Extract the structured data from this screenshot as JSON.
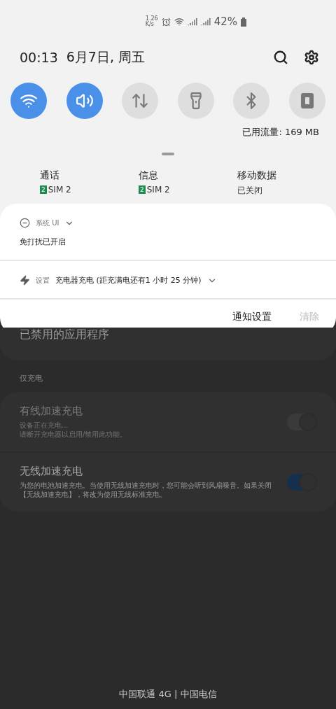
{
  "status_bar": {
    "speed_value": "1.26",
    "speed_unit": "K/s",
    "battery": "42%"
  },
  "header": {
    "time": "00:13",
    "date": "6月7日, 周五"
  },
  "quick_toggles": [
    {
      "kind": "wifi",
      "on": true
    },
    {
      "kind": "sound",
      "on": true
    },
    {
      "kind": "data",
      "on": false
    },
    {
      "kind": "flashlight",
      "on": false
    },
    {
      "kind": "bluetooth",
      "on": false
    },
    {
      "kind": "power",
      "on": false
    }
  ],
  "data_usage": "已用流量: 169 MB",
  "sim_settings": [
    {
      "label": "通话",
      "sim_badge": "2",
      "value": "SIM 2"
    },
    {
      "label": "信息",
      "sim_badge": "2",
      "value": "SIM 2"
    },
    {
      "label": "移动数据",
      "value": "已关闭"
    }
  ],
  "notifications": [
    {
      "kind": "dnd",
      "app": "系统 UI",
      "text": "免打扰已开启"
    },
    {
      "kind": "charging",
      "app": "设置",
      "text": "充电器充电 (距充满电还有1 小时 25 分钟)"
    }
  ],
  "notification_actions": [
    {
      "label": "通知设置",
      "disabled": false
    },
    {
      "label": "清除",
      "disabled": true
    }
  ],
  "background_page": {
    "top_item": "已禁用的应用程序",
    "section": "仅充电",
    "rows": [
      {
        "title": "有线加速充电",
        "description": "设备正在充电...\n请断开充电器以启用/禁用此功能。",
        "on": true,
        "disabled": true
      },
      {
        "title": "无线加速充电",
        "description": "为您的电池加速充电。当使用无线加速充电时，您可能会听到风扇噪音。如果关闭【无线加速充电】，将改为使用无线标准充电。",
        "on": true,
        "disabled": false
      }
    ]
  },
  "carrier": "中国联通 4G | 中国电信"
}
